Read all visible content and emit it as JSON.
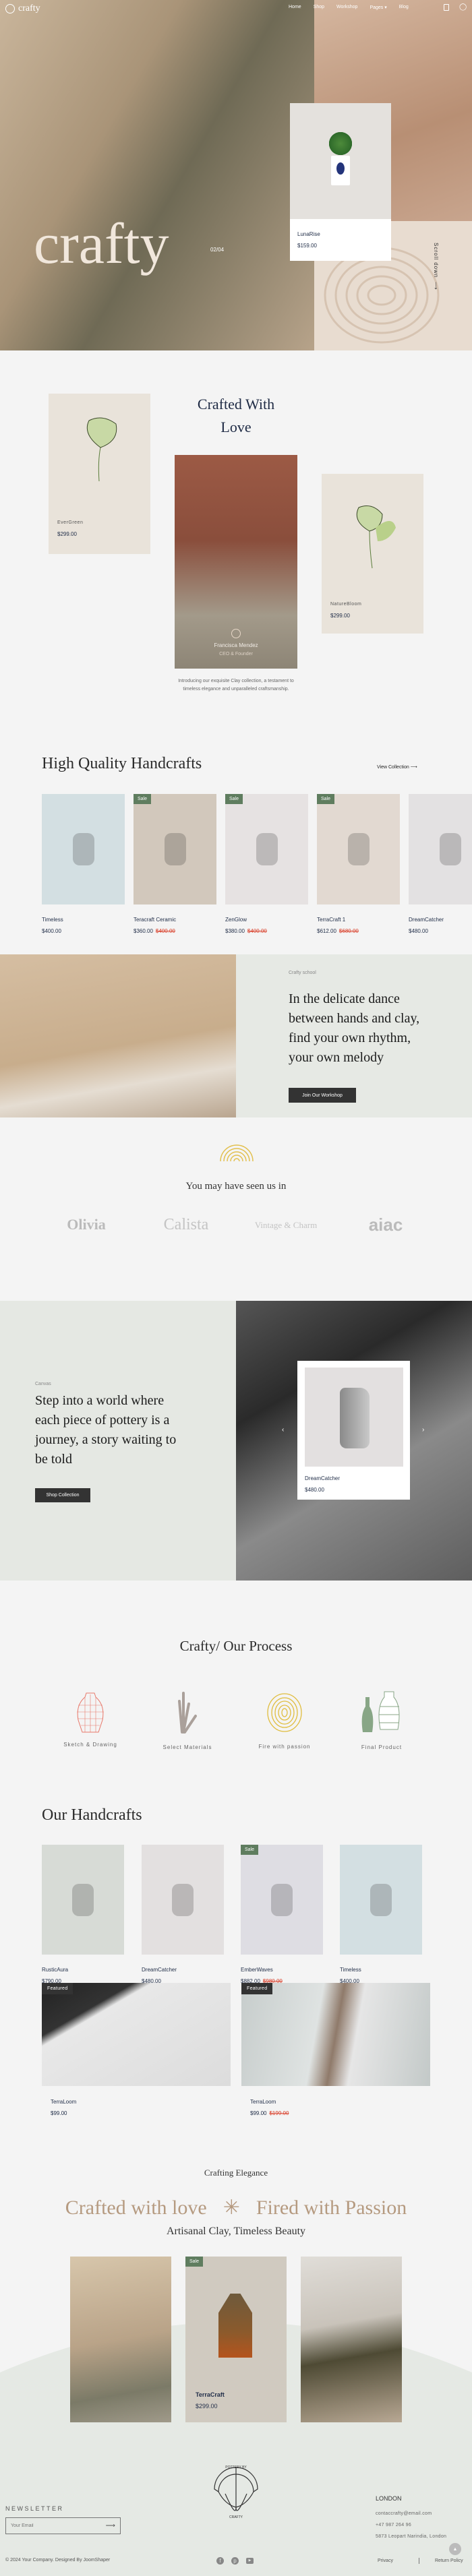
{
  "colors": {
    "accent_sale": "#5f7d5f",
    "price_old": "#d9402b",
    "section_bg": "#e6e9e4",
    "dark_button": "#333333",
    "tan_heading": "#b59a80"
  },
  "header": {
    "logo": "crafty",
    "nav": [
      "Home",
      "Shop",
      "Workshop",
      "Pages",
      "Blog"
    ],
    "icons": [
      "bag-icon",
      "user-icon"
    ]
  },
  "hero": {
    "title": "crafty",
    "slide": "02/04",
    "scroll": "Scroll down",
    "card": {
      "name": "LunaRise",
      "price": "$159.00"
    }
  },
  "crafted": {
    "title_line1": "Crafted With",
    "title_line2": "Love",
    "left_card": {
      "name": "EverGreen",
      "price": "$299.00"
    },
    "right_card": {
      "name": "NatureBloom",
      "price": "$299.00"
    },
    "person": {
      "name": "Francisca Mendez",
      "role": "CEO & Founder"
    },
    "description": "Introducing our exquisite Clay collection, a testament to timeless elegance and unparalleled craftsmanship."
  },
  "quality": {
    "title": "High Quality Handcrafts",
    "link": "View Collection",
    "products": [
      {
        "name": "Timeless",
        "price": "$400.00",
        "old": "",
        "sale": ""
      },
      {
        "name": "Teracraft Ceramic",
        "price": "$360.00",
        "old": "$400.00",
        "sale": "Sale"
      },
      {
        "name": "ZenGlow",
        "price": "$380.00",
        "old": "$400.00",
        "sale": "Sale"
      },
      {
        "name": "TerraCraft 1",
        "price": "$612.00",
        "old": "$680.00",
        "sale": "Sale"
      },
      {
        "name": "DreamCatcher",
        "price": "$480.00",
        "old": "",
        "sale": ""
      }
    ]
  },
  "workshop": {
    "eyebrow": "Crafty school",
    "heading_lines": [
      "In the delicate dance",
      "between hands and clay,",
      "find your own rhythm,",
      "your own melody"
    ],
    "button": "Join Our Workshop"
  },
  "seen": {
    "title": "You may have seen us in",
    "brands": [
      "Olivia",
      "Calista",
      "Vintage & Charm",
      "aiac"
    ]
  },
  "canvas": {
    "eyebrow": "Canvas",
    "heading_lines": [
      "Step into a world where",
      "each piece of pottery is a",
      "journey, a story waiting to",
      "be told"
    ],
    "button": "Shop Collection",
    "card": {
      "name": "DreamCatcher",
      "price": "$480.00"
    }
  },
  "process": {
    "title": "Crafty/ Our Process",
    "steps": [
      "Sketch & Drawing",
      "Select Materials",
      "Fire with passion",
      "Final Product"
    ]
  },
  "handcrafts": {
    "title": "Our Handcrafts",
    "products": [
      {
        "name": "RusticAura",
        "price": "$790.00",
        "old": "",
        "sale": ""
      },
      {
        "name": "DreamCatcher",
        "price": "$480.00",
        "old": "",
        "sale": ""
      },
      {
        "name": "EmberWaves",
        "price": "$882.00",
        "old": "$980.00",
        "sale": "Sale"
      },
      {
        "name": "Timeless",
        "price": "$400.00",
        "old": "",
        "sale": ""
      }
    ],
    "featured": [
      {
        "badge": "Featured",
        "name": "TerraLoom",
        "price": "$99.00",
        "old": ""
      },
      {
        "badge": "Featured",
        "name": "TerraLoom",
        "price": "$99.00",
        "old": "$199.00"
      }
    ]
  },
  "elegance": {
    "eyebrow": "Crafting Elegance",
    "left": "Crafted with love",
    "right": "Fired with Passion",
    "subtitle": "Artisanal Clay, Timeless Beauty",
    "card": {
      "sale": "Sale",
      "name": "TerraCraft",
      "price": "$299.00"
    }
  },
  "footer": {
    "logo_text": "POTTERY BY CRAFTY",
    "newsletter": "NEWSLETTER",
    "email_placeholder": "Your Email",
    "city": "LONDON",
    "email": "contaccrafty@email.com",
    "phone": "+47 987 264 96",
    "address": "5873 Leopart Narindia, London",
    "copyright": "© 2024 Your Company. Designed By JoomShaper",
    "links": [
      "Privacy",
      "Return Policy"
    ],
    "social": [
      "facebook-icon",
      "pinterest-icon",
      "youtube-icon"
    ]
  }
}
